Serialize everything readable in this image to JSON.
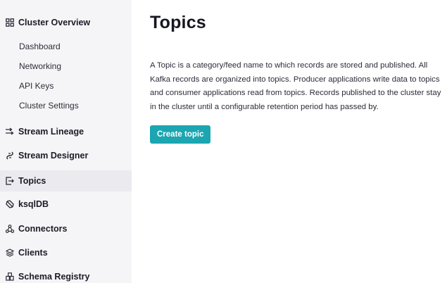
{
  "sidebar": {
    "cluster_overview": "Cluster Overview",
    "sub_items": [
      "Dashboard",
      "Networking",
      "API Keys",
      "Cluster Settings"
    ],
    "stream_lineage": "Stream Lineage",
    "stream_designer": "Stream Designer",
    "topics": "Topics",
    "ksqldb": "ksqlDB",
    "connectors": "Connectors",
    "clients": "Clients",
    "schema_registry": "Schema Registry",
    "active_item": "Topics"
  },
  "main": {
    "title": "Topics",
    "description": "A Topic is a category/feed name to which records are stored and published. All Kafka records are organized into topics. Producer applications write data to topics and consumer applications read from topics. Records published to the cluster stay in the cluster until a configurable retention period has passed by.",
    "create_button": "Create topic"
  },
  "colors": {
    "accent": "#1ba6b1",
    "sidebar_bg": "#f5f5f7",
    "active_bg": "#ebebef"
  }
}
